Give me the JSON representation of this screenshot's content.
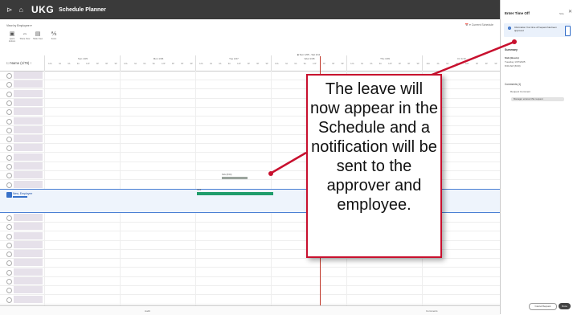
{
  "app": {
    "logo": "UKG",
    "title": "Schedule Planner"
  },
  "toolbar": {
    "view_by": "View by Employee ▾",
    "buttons": [
      {
        "glyph": "▣",
        "label": "Quick Actions"
      },
      {
        "glyph": "⇔",
        "label": "Share View"
      },
      {
        "glyph": "▤",
        "label": "Table View"
      },
      {
        "glyph": "⅍",
        "label": "Zoom"
      }
    ],
    "right_control": "📅 ▾  Current Schedule"
  },
  "schedule": {
    "date_range": "■ Sun 1/05 - Sat 1/11",
    "name_header": "Name (1/79)",
    "days": [
      "Sun 1/05",
      "Mon 1/06",
      "Tue 1/07",
      "Wed 1/08",
      "Thu 1/09",
      "Fri 1/10"
    ],
    "hours": [
      "12A",
      "3A",
      "6A",
      "9A",
      "12P",
      "3P",
      "6P",
      "9P"
    ],
    "selected_employee": "New, Employee",
    "time_off_label": "Sick (8:00)",
    "shift_label": "Shift"
  },
  "bottom": {
    "audit": "Audit",
    "comments": "Comments"
  },
  "panel": {
    "title": "Enter Time Off",
    "size": "Size",
    "close": "✕",
    "info_text": "Information Your time off request has been approved",
    "summary_heading": "Summary",
    "item_title": "Sick (Hours)",
    "item_date": "Tuesday 1/07/2025",
    "item_time": "8:00 AM (8:00)",
    "comments_heading": "Comments (1)",
    "comments_sub": "Request Comment",
    "comment_chip": "Manager entered this request",
    "cancel_button": "Cancel Request",
    "done_button": "Done"
  },
  "callout": {
    "text": "The leave will now appear in the Schedule and a notification will be sent to the approver and employee."
  }
}
